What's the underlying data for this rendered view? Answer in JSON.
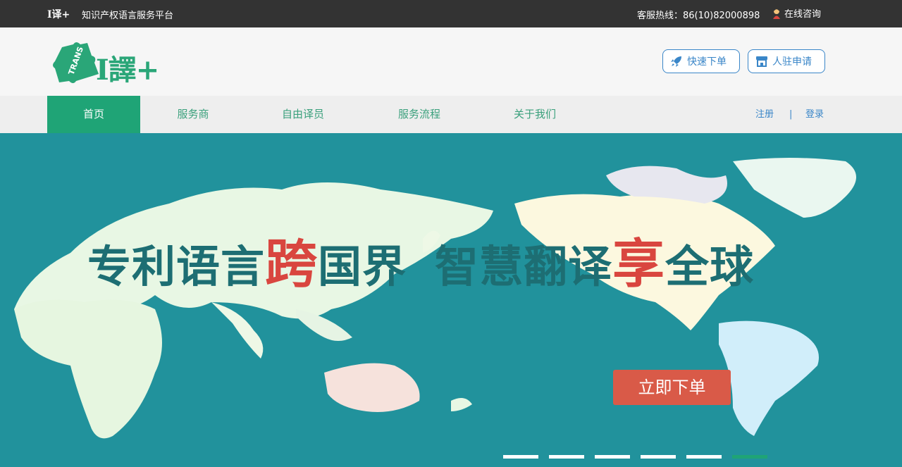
{
  "topbar": {
    "brand": "I译+",
    "slogan": "知识产权语言服务平台",
    "hotline": "客服热线：86(10)82000898",
    "consult": "在线咨询"
  },
  "header": {
    "logo_text": "I譯+",
    "logo_badge": "TRANS",
    "buttons": {
      "order": "快速下单",
      "join": "人驻申请"
    }
  },
  "nav": {
    "items": [
      {
        "label": "首页",
        "active": true
      },
      {
        "label": "服务商",
        "active": false
      },
      {
        "label": "自由译员",
        "active": false
      },
      {
        "label": "服务流程",
        "active": false
      },
      {
        "label": "关于我们",
        "active": false
      }
    ],
    "register": "注册",
    "separator": "|",
    "login": "登录"
  },
  "banner": {
    "headline_part1": "专利语言",
    "headline_hl1": "跨",
    "headline_part2": "国界",
    "headline_part3": "智慧翻译",
    "headline_hl2": "享",
    "headline_part4": "全球",
    "cta": "立即下单",
    "slides": 6,
    "active_slide": 6
  },
  "colors": {
    "topbar_bg": "#333333",
    "brand_green": "#1fa476",
    "link_blue": "#3a86c8",
    "banner_sea": "#21929c",
    "cta_red": "#d95a48",
    "headline_dark": "#1d6e73",
    "headline_highlight": "#d9463f"
  }
}
